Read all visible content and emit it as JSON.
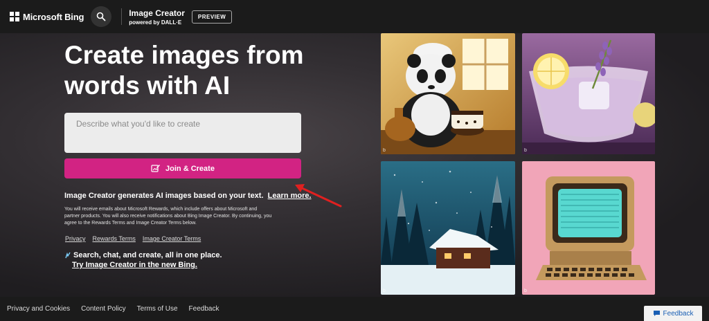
{
  "header": {
    "brand": "Microsoft Bing",
    "title": "Image Creator",
    "subtitle": "powered by DALL·E",
    "badge": "PREVIEW",
    "icons": [
      "microsoft-logo-icon",
      "search-icon"
    ]
  },
  "hero": {
    "headline": "Create images from words with AI",
    "prompt_placeholder": "Describe what you'd like to create",
    "join_label": "Join & Create",
    "info_text": "Image Creator generates AI images based on your text.",
    "info_link": "Learn more.",
    "fine_print": "You will receive emails about Microsoft Rewards, which include offers about Microsoft and partner products. You will also receive notifications about Bing Image Creator. By continuing, you agree to the Rewards Terms and Image Creator Terms below.",
    "links": [
      "Privacy",
      "Rewards Terms",
      "Image Creator Terms"
    ],
    "promo_line1": "Search, chat, and create, all in one place.",
    "promo_line2": "Try Image Creator in the new Bing."
  },
  "gallery": {
    "tiles": [
      {
        "subject": "panda-chef-image"
      },
      {
        "subject": "lavender-cocktail-image"
      },
      {
        "subject": "snowy-cabin-image"
      },
      {
        "subject": "retro-computer-image"
      }
    ],
    "corner_mark": "b"
  },
  "footer": {
    "links": [
      "Privacy and Cookies",
      "Content Policy",
      "Terms of Use",
      "Feedback"
    ],
    "feedback_button": "Feedback"
  },
  "colors": {
    "accent": "#d22383",
    "header_bg": "#1b1b1b",
    "annotation_arrow": "#e02020"
  }
}
